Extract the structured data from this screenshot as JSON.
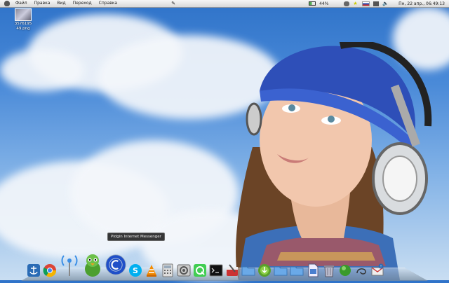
{
  "menubar": {
    "items": [
      "Файл",
      "Правка",
      "Вид",
      "Переход",
      "Справка"
    ],
    "battery": "44%",
    "clock": "Пн, 22 апр., 06:49:13"
  },
  "desktop": {
    "icon_label_1": "3576195",
    "icon_label_2": "49.png"
  },
  "dock": {
    "tooltip": "Pidgin Internet Messenger",
    "items": [
      {
        "name": "anchor-icon"
      },
      {
        "name": "chrome-icon"
      },
      {
        "name": "antenna-icon"
      },
      {
        "name": "pidgin-icon"
      },
      {
        "name": "globe-icon"
      },
      {
        "name": "skype-icon"
      },
      {
        "name": "vlc-icon"
      },
      {
        "name": "calculator-icon"
      },
      {
        "name": "settings-icon"
      },
      {
        "name": "qt-icon"
      },
      {
        "name": "terminal-icon"
      },
      {
        "name": "tools-icon"
      },
      {
        "name": "folder-icon"
      },
      {
        "name": "torrent-icon"
      },
      {
        "name": "folder-icon"
      },
      {
        "name": "folder-icon"
      },
      {
        "name": "file-icon"
      },
      {
        "name": "trash-icon"
      },
      {
        "name": "green-ball-icon"
      },
      {
        "name": "swirl-icon"
      },
      {
        "name": "mail-icon"
      }
    ]
  },
  "colors": {
    "sky": "#3d7fd4",
    "hat": "#2e4fb8"
  }
}
